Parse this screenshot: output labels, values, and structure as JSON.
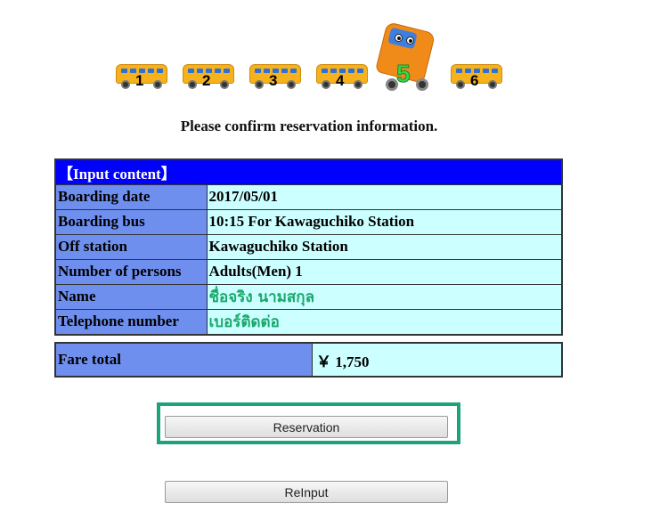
{
  "steps": {
    "items": [
      {
        "number": "1"
      },
      {
        "number": "2"
      },
      {
        "number": "3"
      },
      {
        "number": "4"
      },
      {
        "number": "5",
        "current": true
      },
      {
        "number": "6"
      }
    ]
  },
  "page": {
    "heading": "Please confirm reservation information."
  },
  "table": {
    "header": "【Input content】",
    "rows": [
      {
        "label": "Boarding date",
        "value": "2017/05/01"
      },
      {
        "label": "Boarding bus",
        "value": "10:15 For Kawaguchiko Station"
      },
      {
        "label": "Off station",
        "value": "Kawaguchiko Station"
      },
      {
        "label": "Number of persons",
        "value": "Adults(Men) 1"
      },
      {
        "label": "Name",
        "value": "ชื่อจริง  นามสกุล"
      },
      {
        "label": "Telephone number",
        "value": "เบอร์ติดต่อ"
      }
    ],
    "fare_label": "Fare total",
    "fare_value": "￥ 1,750"
  },
  "buttons": {
    "reservation": "Reservation",
    "reinput": "ReInput"
  },
  "colors": {
    "header_bg": "#0000ff",
    "label_bg": "#6f8fef",
    "value_bg": "#ccffff",
    "highlight_border": "#1aa37c",
    "thai_text": "#1aa86b"
  }
}
